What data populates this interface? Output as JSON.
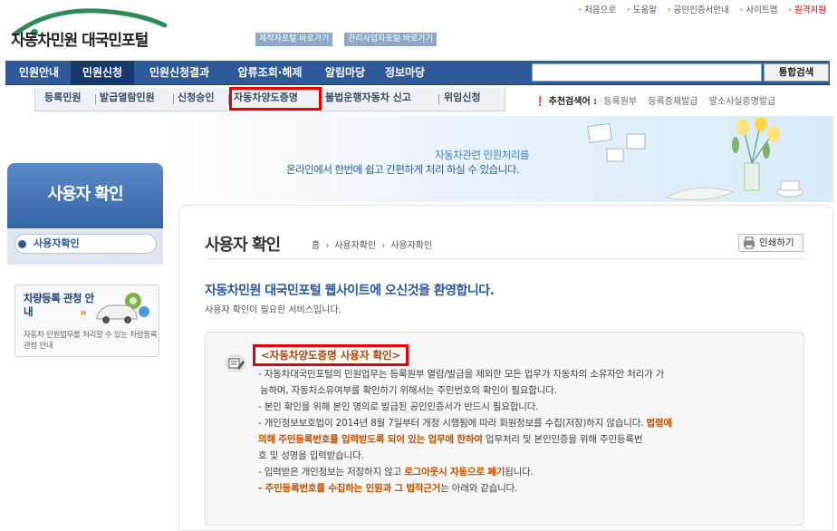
{
  "header": {
    "site_title": "자동차민원 대국민포털",
    "quick_links": [
      "제작자포털 바로가기",
      "관리사업자포털 바로가기"
    ],
    "util_links": [
      "처음으로",
      "도움말",
      "공인인증서안내",
      "사이트맵",
      "원격지원"
    ]
  },
  "gnb": {
    "items": [
      "민원안내",
      "민원신청",
      "민원신청결과",
      "압류조회·해제",
      "알림마당",
      "정보마당"
    ],
    "active": "민원신청",
    "search_button": "통합검색"
  },
  "lnb": {
    "items": [
      "등록민원",
      "발급열람민원",
      "신청승인",
      "자동차양도증명",
      "불법운행자동차 신고",
      "위임신청"
    ],
    "highlighted": "자동차양도증명"
  },
  "recommend": {
    "label": "추천검색어 :",
    "keywords": [
      "등록원부",
      "등록증재발급",
      "말소사실증명발급"
    ]
  },
  "banner": {
    "line1": "자동차관련 민원처리를",
    "line2": "온라인에서 한번에 쉽고 간편하게 처리 하실 수 있습니다."
  },
  "side": {
    "title": "사용자 확인",
    "menu_item": "사용자확인",
    "promo_title": "차량등록 관청 안내",
    "promo_arrow": "»",
    "promo_desc": "자동차 민원업무를 처리할 수 있는 차량등록관청 안내"
  },
  "content": {
    "page_title": "사용자 확인",
    "breadcrumb": [
      "홈",
      "사용자확인",
      "사용자확인"
    ],
    "print_label": "인쇄하기",
    "welcome": "자동차민원 대국민포털 웹사이트에 오신것을 환영합니다.",
    "welcome_sub": "사용자 확인이 필요한 서비스입니다.",
    "info_title": "<자동차양도증명 사용자 확인>",
    "info_lines": {
      "l1": "- 자동차대국민포털의 민원업무는 등록원부 열람/발급을 제외한 모든 업무가 자동차의 소유자만 처리가 가",
      "l2": "능하며, 자동차소유여부를 확인하기 위해서는 주민번호의 확인이 필요합니다.",
      "l3": "- 본인 확인을 위해 본인 명의로 발급된 공인인증서가 반드시 필요합니다.",
      "l4a": "- 개인정보보호법이 2014년 8월 7일부터 개정 시행됨에 따라 회원정보를 수집(저장)하지 않습니다. ",
      "l4b": "법령에",
      "l5a": "의해 주민등록번호를 입력받도록 되어 있는 업무에 한하여",
      "l5b": " 업무처리 및 본인인증을 위해 주민등록번",
      "l6": "호 및 성명을 입력받습니다.",
      "l7a": "- 입력받은 개인정보는 저장하지 않고 ",
      "l7b": "로그아웃시 자동으로 폐기",
      "l7c": "됩니다.",
      "l8a": "- 주민등록번호를 수집하는 민원과 그 법적근거",
      "l8b": "는 아래와 같습니다."
    }
  },
  "colors": {
    "nav_bg": "#2f5a9a",
    "highlight_border": "#e80000",
    "accent_text": "#c05000"
  }
}
